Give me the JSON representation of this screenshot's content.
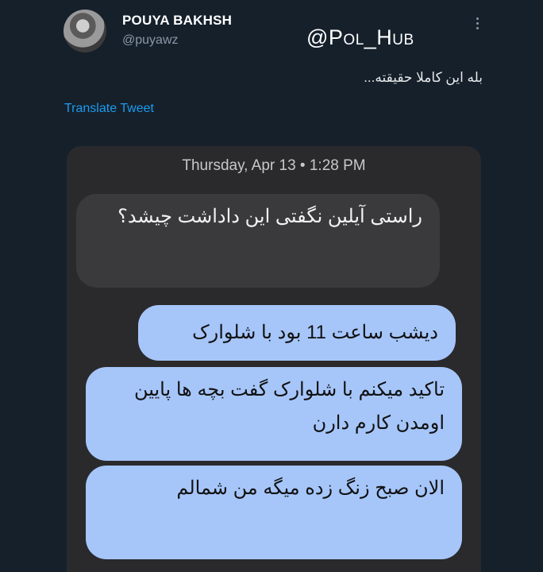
{
  "tweet": {
    "display_name": "POUYA BAKHSH",
    "handle": "@puyawz",
    "text": "بله این کاملا حقیقته...",
    "translate_label": "Translate Tweet"
  },
  "watermark": "@Pol_Hub",
  "icons": {
    "avatar": "avatar",
    "more": "more-vertical-icon"
  },
  "screenshot": {
    "date_stamp": "Thursday, Apr 13 • 1:28 PM",
    "messages": [
      {
        "direction": "received",
        "text": "راستی آیلین نگفتی این داداشت چیشد؟"
      },
      {
        "direction": "sent",
        "text": "دیشب ساعت 11 بود با شلوارک"
      },
      {
        "direction": "sent",
        "text": "تاکید میکنم با شلوارک گفت بچه ها پایین اومدن کارم دارن"
      },
      {
        "direction": "sent",
        "text": "الان صبح زنگ زده میگه من شمالم"
      }
    ]
  },
  "colors": {
    "background": "#15202b",
    "link": "#1d9bf0",
    "sent_bubble": "#a6c6fa",
    "received_bubble": "#3a3a3c"
  }
}
